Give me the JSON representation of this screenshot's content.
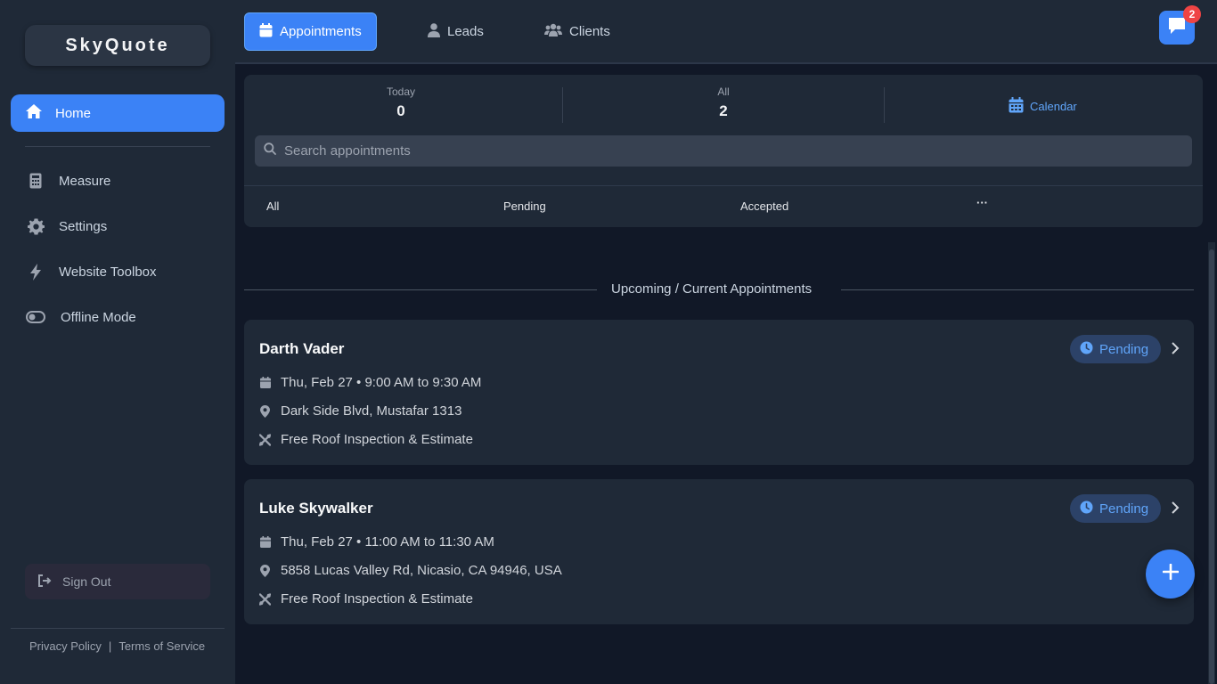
{
  "app": {
    "name": "SkyQuote"
  },
  "sidebar": {
    "home": {
      "label": "Home",
      "icon": "home-icon"
    },
    "items": [
      {
        "label": "Measure",
        "icon": "calculator-icon"
      },
      {
        "label": "Settings",
        "icon": "gear-icon"
      },
      {
        "label": "Website Toolbox",
        "icon": "bolt-icon"
      },
      {
        "label": "Offline Mode",
        "icon": "toggle-icon"
      }
    ],
    "sign_out": "Sign Out",
    "footer": {
      "privacy": "Privacy Policy",
      "separator": "|",
      "terms": "Terms of Service"
    }
  },
  "topbar": {
    "tabs": [
      {
        "label": "Appointments",
        "icon": "calendar-icon",
        "active": true
      },
      {
        "label": "Leads",
        "icon": "user-icon",
        "active": false
      },
      {
        "label": "Clients",
        "icon": "users-icon",
        "active": false
      }
    ],
    "chat_badge": "2"
  },
  "stats": {
    "today": {
      "label": "Today",
      "value": "0"
    },
    "all": {
      "label": "All",
      "value": "2"
    },
    "calendar_label": "Calendar"
  },
  "search": {
    "placeholder": "Search appointments",
    "value": ""
  },
  "filters": [
    "All",
    "Pending",
    "Accepted",
    "···"
  ],
  "section_title": "Upcoming / Current Appointments",
  "appointments": [
    {
      "name": "Darth Vader",
      "status": "Pending",
      "datetime": "Thu, Feb 27 • 9:00 AM to 9:30 AM",
      "address": "Dark Side Blvd, Mustafar 1313",
      "service": "Free Roof Inspection & Estimate"
    },
    {
      "name": "Luke Skywalker",
      "status": "Pending",
      "datetime": "Thu, Feb 27 • 11:00 AM to 11:30 AM",
      "address": "5858 Lucas Valley Rd, Nicasio, CA 94946, USA",
      "service": "Free Roof Inspection & Estimate"
    }
  ],
  "colors": {
    "background": "#111827",
    "panel": "#1f2937",
    "accent": "#3b82f6",
    "accent_text": "#60a5fa",
    "badge": "#ef4444"
  }
}
